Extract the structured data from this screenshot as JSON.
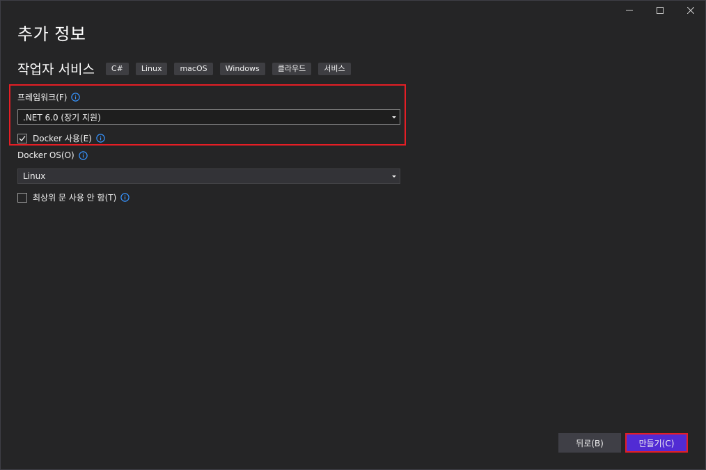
{
  "window": {
    "controls": [
      "minimize",
      "maximize",
      "close"
    ]
  },
  "page": {
    "title": "추가 정보"
  },
  "template": {
    "name": "작업자 서비스",
    "tags": [
      "C#",
      "Linux",
      "macOS",
      "Windows",
      "클라우드",
      "서비스"
    ]
  },
  "framework": {
    "label": "프레임워크(F)",
    "value": ".NET 6.0 (장기 지원)"
  },
  "docker": {
    "label": "Docker 사용(E)",
    "checked": true
  },
  "docker_os": {
    "label": "Docker OS(O)",
    "value": "Linux"
  },
  "top_level": {
    "label": "최상위 문 사용 안 함(T)",
    "checked": false
  },
  "footer": {
    "back_label": "뒤로(B)",
    "create_label": "만들기(C)"
  },
  "colors": {
    "accent": "#512bd4",
    "highlight": "#e51e25",
    "info": "#3794ff"
  },
  "icons": {
    "info": "info-icon",
    "check": "checkmark-icon",
    "dropdown": "chevron-down-icon"
  }
}
